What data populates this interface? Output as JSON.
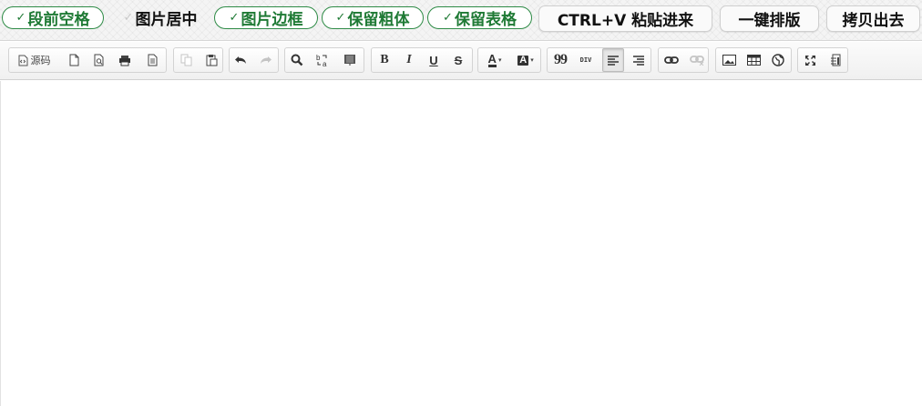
{
  "options": [
    {
      "label": "段前空格",
      "checked": true,
      "check_mark": "✓"
    },
    {
      "label": "图片居中",
      "checked": false,
      "check_mark": "✓"
    },
    {
      "label": "图片边框",
      "checked": true,
      "check_mark": "✓"
    },
    {
      "label": "保留粗体",
      "checked": true,
      "check_mark": "✓"
    },
    {
      "label": "保留表格",
      "checked": true,
      "check_mark": "✓"
    }
  ],
  "actions": [
    {
      "label": "CTRL+V 粘贴进来"
    },
    {
      "label": "一键排版"
    },
    {
      "label": "拷贝出去"
    }
  ],
  "toolbar": {
    "source_label": "源码",
    "bold": "B",
    "italic": "I",
    "underline": "U",
    "strikethrough": "S",
    "font_color": "A",
    "bg_color": "A",
    "quote": "99",
    "div": "DIV",
    "dropdown_caret": "▾",
    "icons": [
      "source-icon",
      "new-page-icon",
      "preview-icon",
      "print-icon",
      "templates-icon",
      "copy-icon",
      "paste-icon",
      "undo-icon",
      "redo-icon",
      "find-icon",
      "replace-icon",
      "select-all-icon",
      "bold-icon",
      "italic-icon",
      "underline-icon",
      "strikethrough-icon",
      "text-color-icon",
      "background-color-icon",
      "blockquote-icon",
      "div-container-icon",
      "align-left-icon",
      "align-right-icon",
      "link-icon",
      "unlink-icon",
      "image-icon",
      "table-icon",
      "iframe-icon",
      "maximize-icon",
      "show-blocks-icon"
    ],
    "active_button": "align-left",
    "colors": {
      "toolbar_bg": "#f0f0f0",
      "icon": "#333333",
      "disabled_icon": "#bdbdbd",
      "active_option": "#1f7a35"
    }
  },
  "editor": {
    "content": ""
  }
}
